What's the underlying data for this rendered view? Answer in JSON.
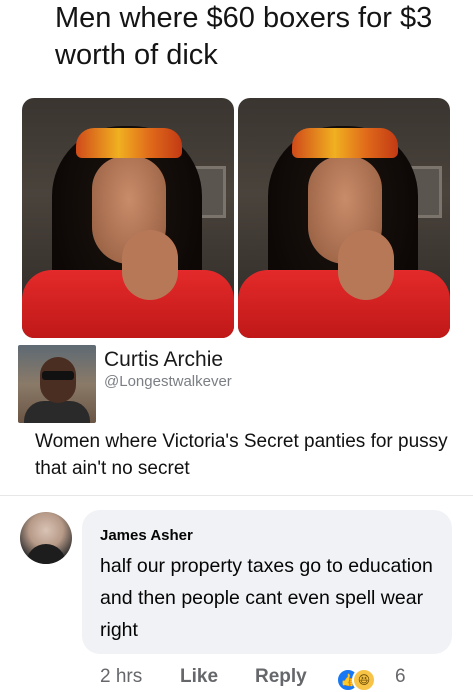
{
  "meme": {
    "headline": "Men where $60 boxers for $3 worth of dick"
  },
  "tweet": {
    "display_name": "Curtis Archie",
    "handle": "@Longestwalkever",
    "text": "Women where Victoria's Secret panties for pussy that ain't no secret"
  },
  "comment": {
    "author": "James Asher",
    "text": "half our property taxes go to education and then people cant even spell wear right",
    "time": "2 hrs",
    "like_label": "Like",
    "reply_label": "Reply",
    "reaction_icons": [
      "like-icon",
      "haha-icon"
    ],
    "reaction_count": "6"
  },
  "colors": {
    "bubble": "#f0f2f5",
    "like_blue": "#1877f2",
    "meta_gray": "#65676b"
  }
}
